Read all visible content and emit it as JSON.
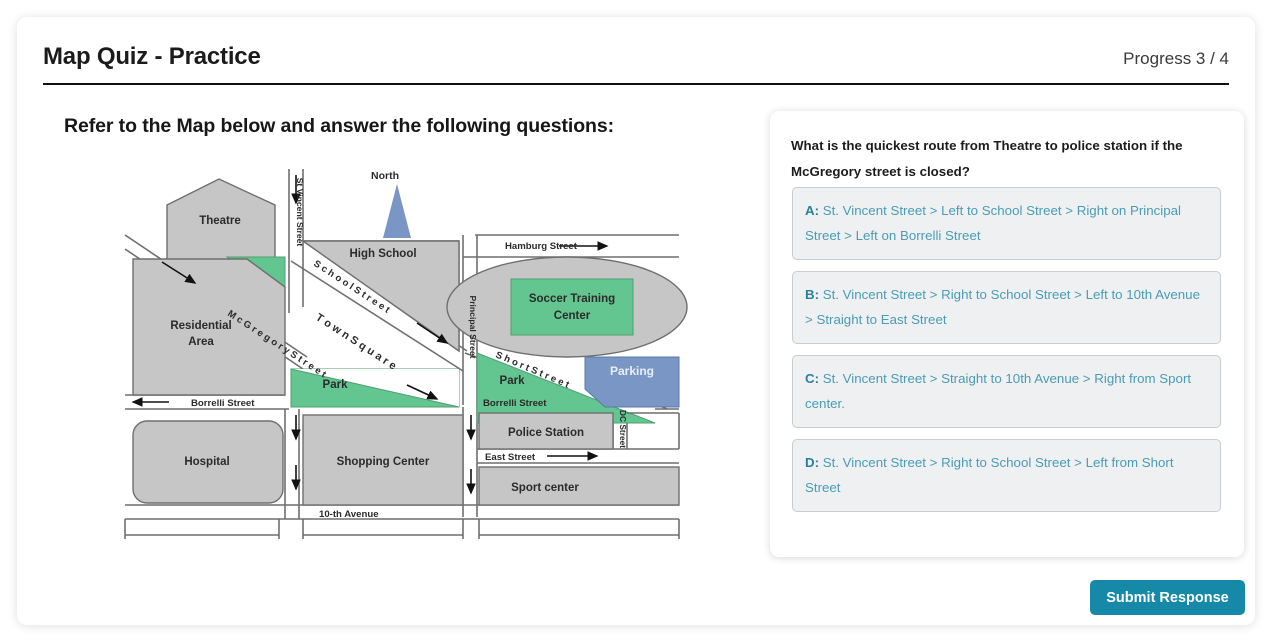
{
  "header": {
    "title": "Map Quiz - Practice",
    "progress": "Progress 3 / 4"
  },
  "instruction": "Refer to the Map below and answer the following questions:",
  "question": {
    "text": "What is the quickest route from Theatre to police station if the McGregory street is closed?",
    "options": [
      {
        "key": "A:",
        "text": " St. Vincent Street > Left to School Street > Right on Principal Street > Left on Borrelli Street"
      },
      {
        "key": "B:",
        "text": " St. Vincent Street > Right to School Street > Left to 10th Avenue > Straight to East Street"
      },
      {
        "key": "C:",
        "text": " St. Vincent Street > Straight to 10th Avenue > Right from Sport center."
      },
      {
        "key": "D:",
        "text": " St. Vincent Street > Right to School Street > Left from Short Street"
      }
    ]
  },
  "submit": {
    "label": "Submit Response"
  },
  "map": {
    "compass": "North",
    "places": {
      "theatre": "Theatre",
      "residential": "Residential\nArea",
      "residential_line1": "Residential",
      "residential_line2": "Area",
      "high_school": "High School",
      "soccer_line1": "Soccer Training",
      "soccer_line2": "Center",
      "parking": "Parking",
      "park_left": "Park",
      "park_right": "Park",
      "hospital": "Hospital",
      "shopping": "Shopping Center",
      "police": "Police Station",
      "sport": "Sport center",
      "town_square": "T o w n   S q u a r e"
    },
    "streets": {
      "st_vincent": "St Vincent Street",
      "mcgregory": "M c G r e g o r y   S t r e e t",
      "school": "S c h o o l   S t r e e t",
      "principal": "Principal Street",
      "hamburg": "Hamburg Street",
      "short": "S h o r t   S t r e e t",
      "borrelli_left": "Borrelli Street",
      "borrelli_right": "Borrelli Street",
      "east": "East Street",
      "dc": "DC Street",
      "tenth": "10-th Avenue"
    }
  },
  "colors": {
    "accent": "#1789a8",
    "option_text": "#4a9cb5",
    "option_bg": "#eef0f2",
    "map_grey": "#c6c6c6",
    "map_green": "#63c58f",
    "map_blue": "#7a96c4"
  }
}
